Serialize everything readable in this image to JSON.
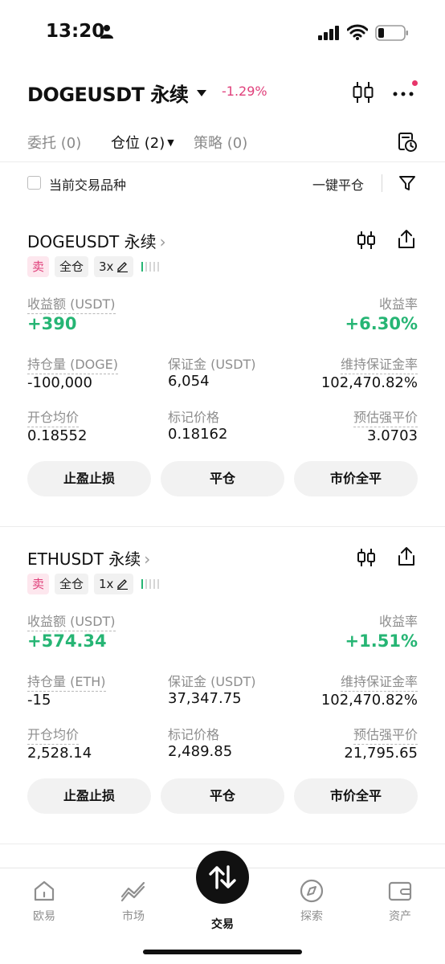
{
  "status": {
    "time": "13:20"
  },
  "header": {
    "pair": "DOGEUSDT 永续",
    "change": "-1.29%"
  },
  "tabs": [
    {
      "label": "委托 (0)"
    },
    {
      "label": "仓位 (2)"
    },
    {
      "label": "策略 (0)"
    }
  ],
  "filter": {
    "checkbox_label": "当前交易品种",
    "close_all": "一键平仓"
  },
  "positions": [
    {
      "title": "DOGEUSDT 永续",
      "side": "卖",
      "margin_mode": "全仓",
      "leverage": "3x",
      "pnl_label": "收益额 (USDT)",
      "pnl": "+390",
      "roe_label": "收益率",
      "roe": "+6.30%",
      "size_label": "持仓量 (DOGE)",
      "size": "-100,000",
      "margin_label": "保证金 (USDT)",
      "margin": "6,054",
      "mmr_label": "维持保证金率",
      "mmr": "102,470.82%",
      "entry_label": "开仓均价",
      "entry": "0.18552",
      "mark_label": "标记价格",
      "mark": "0.18162",
      "liq_label": "预估强平价",
      "liq": "3.0703",
      "btn_tpsl": "止盈止损",
      "btn_close": "平仓",
      "btn_market_close": "市价全平"
    },
    {
      "title": "ETHUSDT 永续",
      "side": "卖",
      "margin_mode": "全仓",
      "leverage": "1x",
      "pnl_label": "收益额 (USDT)",
      "pnl": "+574.34",
      "roe_label": "收益率",
      "roe": "+1.51%",
      "size_label": "持仓量 (ETH)",
      "size": "-15",
      "margin_label": "保证金 (USDT)",
      "margin": "37,347.75",
      "mmr_label": "维持保证金率",
      "mmr": "102,470.82%",
      "entry_label": "开仓均价",
      "entry": "2,528.14",
      "mark_label": "标记价格",
      "mark": "2,489.85",
      "liq_label": "预估强平价",
      "liq": "21,795.65",
      "btn_tpsl": "止盈止损",
      "btn_close": "平仓",
      "btn_market_close": "市价全平"
    }
  ],
  "nav": [
    {
      "label": "欧易",
      "icon": "home-icon"
    },
    {
      "label": "市场",
      "icon": "market-chart-icon"
    },
    {
      "label": "交易",
      "icon": "trade-swap-icon"
    },
    {
      "label": "探索",
      "icon": "compass-icon"
    },
    {
      "label": "资产",
      "icon": "wallet-icon"
    }
  ],
  "colors": {
    "accent_green": "#26b574",
    "accent_red": "#e0407b"
  }
}
